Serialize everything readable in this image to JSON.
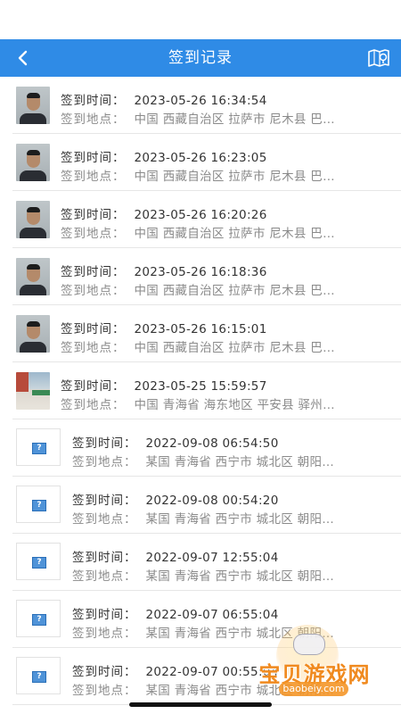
{
  "header": {
    "title": "签到记录",
    "back_icon": "chevron-left-icon",
    "map_icon": "map-location-icon",
    "background": "#2f8be6"
  },
  "label_time": "签到时间：",
  "label_place": "签到地点：",
  "records": [
    {
      "photo": "face",
      "time": "2023-05-26 16:34:54",
      "place": "中国 西藏自治区 拉萨市 尼木县 巴…"
    },
    {
      "photo": "face",
      "time": "2023-05-26 16:23:05",
      "place": "中国 西藏自治区 拉萨市 尼木县 巴…"
    },
    {
      "photo": "face",
      "time": "2023-05-26 16:20:26",
      "place": "中国 西藏自治区 拉萨市 尼木县 巴…"
    },
    {
      "photo": "face",
      "time": "2023-05-26 16:18:36",
      "place": "中国 西藏自治区 拉萨市 尼木县 巴…"
    },
    {
      "photo": "face",
      "time": "2023-05-26 16:15:01",
      "place": "中国 西藏自治区 拉萨市 尼木县 巴…"
    },
    {
      "photo": "room",
      "time": "2023-05-25 15:59:57",
      "place": "中国 青海省 海东地区 平安县 驿州…"
    },
    {
      "photo": "missing",
      "time": "2022-09-08 06:54:50",
      "place": "某国 青海省 西宁市 城北区 朝阳…"
    },
    {
      "photo": "missing",
      "time": "2022-09-08 00:54:20",
      "place": "某国 青海省 西宁市 城北区 朝阳…"
    },
    {
      "photo": "missing",
      "time": "2022-09-07 12:55:04",
      "place": "某国 青海省 西宁市 城北区 朝阳…"
    },
    {
      "photo": "missing",
      "time": "2022-09-07 06:55:04",
      "place": "某国 青海省 西宁市 城北区 朝阳…"
    },
    {
      "photo": "missing",
      "time": "2022-09-07 00:55:04",
      "place": "某国 青海省 西宁市 城北区 朝阳…"
    }
  ],
  "watermark": {
    "text": "宝贝游戏网",
    "url": "baobeiy.com"
  }
}
